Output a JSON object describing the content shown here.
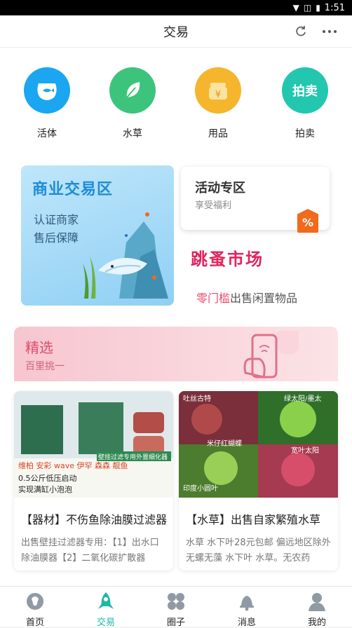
{
  "status_bar": {
    "time": "1:51"
  },
  "header": {
    "title": "交易",
    "refresh_icon": "refresh-icon",
    "more_icon": "more-icon"
  },
  "categories": [
    {
      "label": "活体",
      "icon": "fishbowl-icon",
      "color": "#1aa6f0"
    },
    {
      "label": "水草",
      "icon": "leaf-icon",
      "color": "#3cc47c"
    },
    {
      "label": "用品",
      "icon": "yen-jar-icon",
      "color": "#f5b52c"
    },
    {
      "label": "拍卖",
      "icon": "auction-icon",
      "color": "#23c7b0"
    }
  ],
  "business_zone": {
    "title": "商业交易区",
    "line1": "认证商家",
    "line2": "售后保障"
  },
  "activity_zone": {
    "title": "活动专区",
    "subtitle": "享受福利",
    "badge": "%"
  },
  "flea_market": {
    "logo": "跳蚤市场",
    "highlight": "零门槛",
    "text": "出售闲置物品"
  },
  "selected": {
    "title": "精选",
    "subtitle": "百里挑一"
  },
  "cards": [
    {
      "title": "【器材】不伤鱼除油膜过滤器",
      "desc": "出售壁挂过滤器专用：【1】出水口除油膜器【2】二氧化碳扩散器",
      "img_labels": [
        "维柏",
        "安彩",
        "wave",
        "伊罕",
        "森森",
        "靓鱼",
        "0.5公斤低压启动",
        "实现满缸小泡泡",
        "壁挂过滤专用外置细化器"
      ]
    },
    {
      "title": "【水草】出售自家繁殖水草",
      "desc": "水草 水下叶28元包邮 偏远地区除外 无螺无藻 水下叶 水草。无农药",
      "img_labels": [
        "吐丝古特",
        "绿太阳/墨太",
        "米仔红蝴蝶",
        "印度小圆叶",
        "宽叶太阳"
      ]
    }
  ],
  "tabs": [
    {
      "label": "首页",
      "icon": "home-icon",
      "active": false
    },
    {
      "label": "交易",
      "icon": "rocket-icon",
      "active": true
    },
    {
      "label": "圈子",
      "icon": "circles-icon",
      "active": false
    },
    {
      "label": "消息",
      "icon": "bell-icon",
      "active": false
    },
    {
      "label": "我的",
      "icon": "profile-icon",
      "active": false
    }
  ],
  "colors": {
    "accent": "#1fb8a8",
    "pink": "#e04b6a"
  }
}
